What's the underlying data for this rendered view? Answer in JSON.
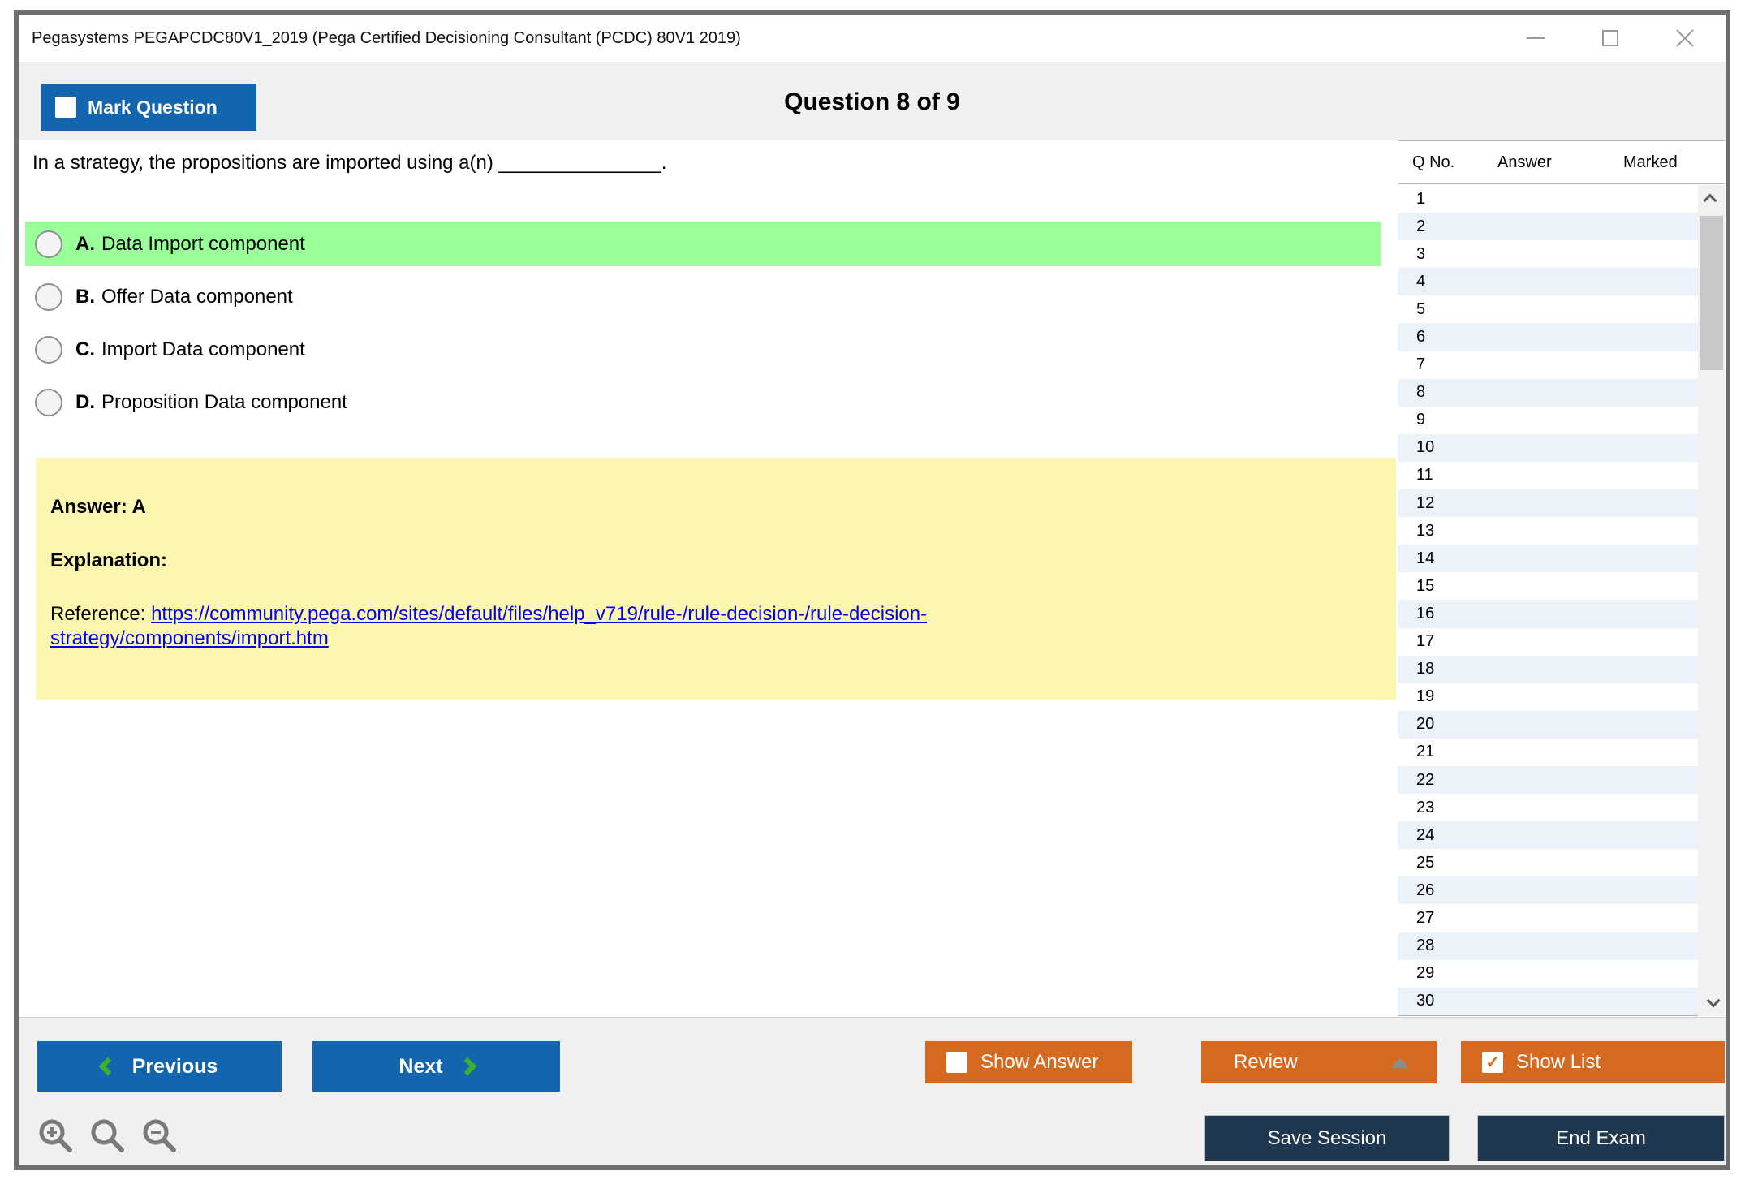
{
  "window": {
    "title": "Pegasystems PEGAPCDC80V1_2019 (Pega Certified Decisioning Consultant (PCDC) 80V1 2019)"
  },
  "header": {
    "mark_question_label": "Mark Question",
    "question_counter": "Question 8 of 9"
  },
  "question": {
    "text": "In a strategy, the propositions are imported using a(n) _______________.",
    "options": [
      {
        "letter": "A.",
        "text": "Data Import component",
        "highlighted": true
      },
      {
        "letter": "B.",
        "text": "Offer Data component",
        "highlighted": false
      },
      {
        "letter": "C.",
        "text": "Import Data component",
        "highlighted": false
      },
      {
        "letter": "D.",
        "text": "Proposition Data component",
        "highlighted": false
      }
    ]
  },
  "answer_panel": {
    "answer_label": "Answer: A",
    "explanation_label": "Explanation:",
    "reference_prefix": "Reference: ",
    "reference_link_lines": [
      "https://community.pega.com/sites/default/files/help_v719/rule-/rule-decision-/rule-decision-",
      "strategy/components/import.htm"
    ]
  },
  "question_list": {
    "columns": [
      "Q No.",
      "Answer",
      "Marked"
    ],
    "rows": [
      "1",
      "2",
      "3",
      "4",
      "5",
      "6",
      "7",
      "8",
      "9",
      "10",
      "11",
      "12",
      "13",
      "14",
      "15",
      "16",
      "17",
      "18",
      "19",
      "20",
      "21",
      "22",
      "23",
      "24",
      "25",
      "26",
      "27",
      "28",
      "29",
      "30"
    ]
  },
  "footer": {
    "previous_label": "Previous",
    "next_label": "Next",
    "show_answer_label": "Show Answer",
    "review_label": "Review",
    "show_list_label": "Show List",
    "save_session_label": "Save Session",
    "end_exam_label": "End Exam"
  },
  "colors": {
    "accent_blue": "#1365AE",
    "accent_orange": "#D4691F",
    "accent_navy": "#20384F",
    "chevron_green": "#3DB229",
    "highlight_green": "#99FF99",
    "explanation_yellow": "#FBF7AE",
    "alt_row_blue": "#EBF2F9",
    "link_blue": "#0000EE",
    "band_gray": "#F0F0F0",
    "window_border": "#6E6E6E"
  }
}
